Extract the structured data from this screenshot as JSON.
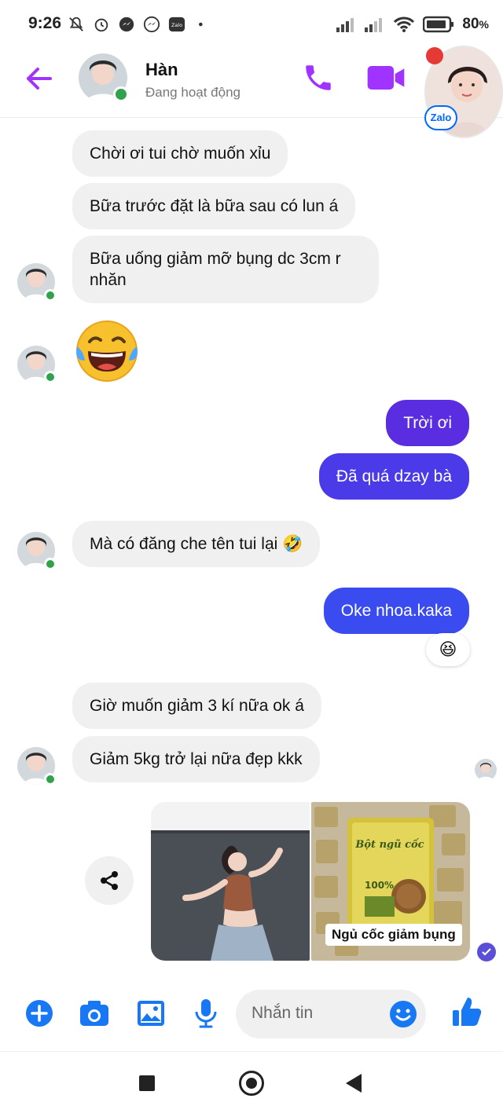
{
  "status_bar": {
    "time": "9:26",
    "battery": "80",
    "icons": [
      "mute-icon",
      "alarm-icon",
      "messenger-icon",
      "messenger-icon",
      "zalo-icon",
      "dot-icon",
      "signal-icon",
      "signal-icon",
      "wifi-icon",
      "battery-icon"
    ]
  },
  "header": {
    "name": "Hàn",
    "status": "Đang hoạt động",
    "zalo_label": "Zalo",
    "accent_color": "#a033ff"
  },
  "messages": [
    {
      "side": "in",
      "text": "Chời ơi tui chờ muốn xỉu"
    },
    {
      "side": "in",
      "text": "Bữa trước đặt là bữa sau có lun á"
    },
    {
      "side": "in",
      "text": "Bữa uống giảm mỡ bụng dc 3cm r nhăn"
    },
    {
      "side": "in",
      "type": "emoji",
      "text": "😂"
    },
    {
      "side": "out",
      "text": "Trời ơi"
    },
    {
      "side": "out",
      "text": "Đã quá dzay bà"
    },
    {
      "side": "in",
      "text": "Mà có đăng che tên tui lại 🤣"
    },
    {
      "side": "out",
      "text": "Oke nhoa.kaka",
      "reaction": "😆"
    },
    {
      "side": "in",
      "text": "Giờ muốn giảm 3 kí nữa ok á"
    },
    {
      "side": "in",
      "text": "Giảm 5kg trở lại nữa đẹp kkk"
    }
  ],
  "attachments": {
    "photo_caption": "Ngủ cốc giảm bụng",
    "product_label_line1": "Bột ngũ cốc",
    "product_label_line2": "100%"
  },
  "composer": {
    "placeholder": "Nhắn tin",
    "brand_blue": "#1877f2"
  }
}
